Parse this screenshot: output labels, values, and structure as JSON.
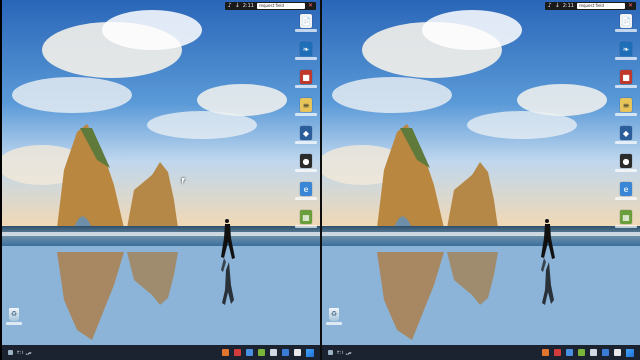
{
  "layout": {
    "screens": 2
  },
  "desktop": {
    "wallpaper": "beach-sea-stacks-runner",
    "topbar": {
      "bell_symbol": "♪",
      "arrow_symbol": "↓",
      "time": "2:11",
      "search_text": "request field",
      "close_symbol": "✕"
    },
    "icons": [
      {
        "name": "file-icon",
        "glyph": "📄",
        "color": "#f2f2f2"
      },
      {
        "name": "bird-app-icon",
        "glyph": "❧",
        "color": "#1e6fb8"
      },
      {
        "name": "red-app-icon",
        "glyph": "■",
        "color": "#c0392b"
      },
      {
        "name": "document-icon",
        "glyph": "≡",
        "color": "#e8c55a"
      },
      {
        "name": "blue-app-icon",
        "glyph": "◆",
        "color": "#2a5d9a"
      },
      {
        "name": "dark-app-icon",
        "glyph": "●",
        "color": "#2b2b2b"
      },
      {
        "name": "ie-icon",
        "glyph": "e",
        "color": "#3a86d6"
      },
      {
        "name": "colorful-app-icon",
        "glyph": "▦",
        "color": "#6a9e3a"
      }
    ],
    "recycle_bin": {
      "glyph": "♻"
    },
    "taskbar": {
      "clock_text": "ص ٢:١",
      "tray_icons": [
        "orange-app",
        "red-app",
        "blue-app",
        "green-app",
        "gray-app",
        "word-app",
        "white-app"
      ]
    }
  }
}
